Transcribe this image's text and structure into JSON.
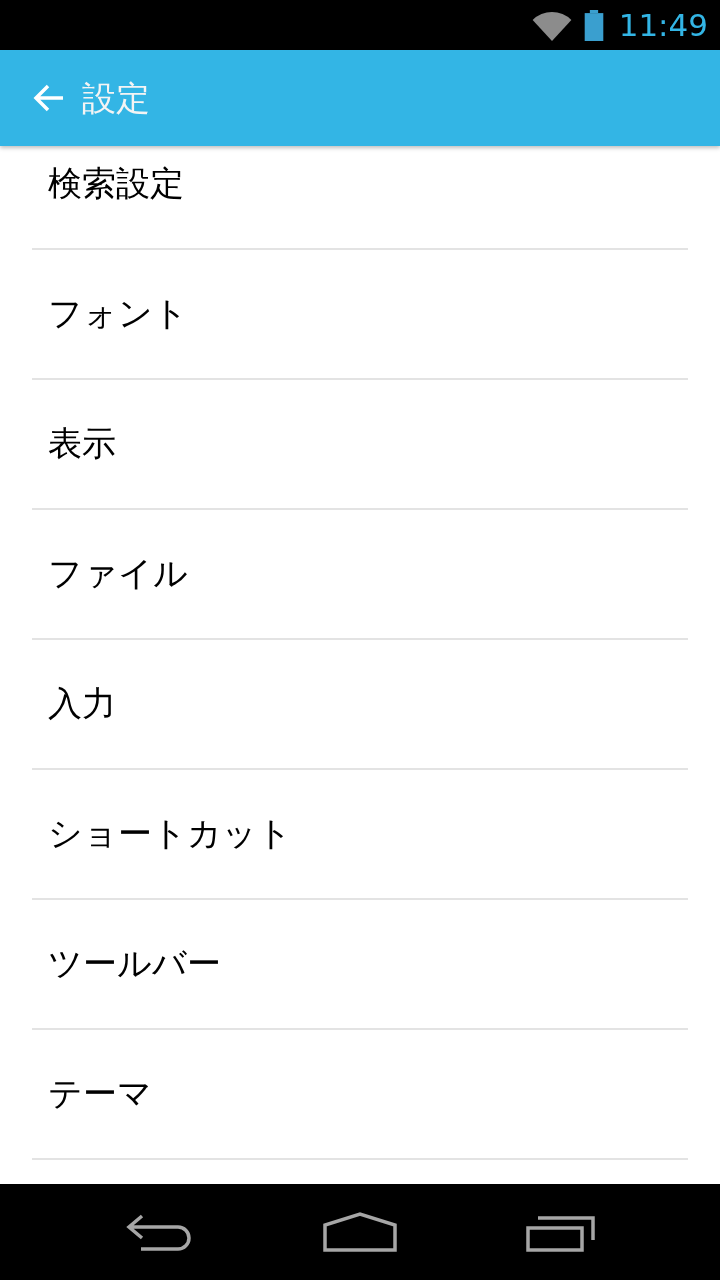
{
  "status_bar": {
    "time": "11:49"
  },
  "app_bar": {
    "title": "設定"
  },
  "settings_list": {
    "items": [
      {
        "label": "検索設定"
      },
      {
        "label": "フォント"
      },
      {
        "label": "表示"
      },
      {
        "label": "ファイル"
      },
      {
        "label": "入力"
      },
      {
        "label": "ショートカット"
      },
      {
        "label": "ツールバー"
      },
      {
        "label": "テーマ"
      }
    ]
  }
}
